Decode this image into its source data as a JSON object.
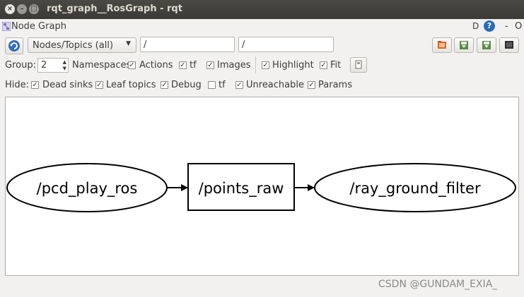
{
  "window": {
    "title": "rqt_graph__RosGraph - rqt",
    "close_glyph": "×",
    "min_glyph": "–",
    "max_glyph": "□"
  },
  "plugin": {
    "title": "Node Graph",
    "d_label": "D",
    "help_label": "?",
    "dash_label": "-",
    "o_label": "O"
  },
  "toolbar": {
    "mode_combo": "Nodes/Topics (all)",
    "node_filter": "/",
    "topic_filter": "/",
    "buttons": [
      "load-dot-icon",
      "save-dot-icon",
      "save-svg-icon",
      "save-image-icon"
    ]
  },
  "options": {
    "group_label": "Group:",
    "group_value": "2",
    "items": [
      {
        "label": "Namespaces",
        "checked": true
      },
      {
        "label": "Actions",
        "checked": true
      },
      {
        "label": "tf",
        "checked": true
      },
      {
        "label": "Images",
        "checked": true
      },
      {
        "label": "Highlight",
        "checked": true
      },
      {
        "label": "Fit",
        "checked": true
      }
    ]
  },
  "hide": {
    "label": "Hide:",
    "items": [
      {
        "label": "Dead sinks",
        "checked": true
      },
      {
        "label": "Leaf topics",
        "checked": true
      },
      {
        "label": "Debug",
        "checked": true
      },
      {
        "label": "tf",
        "checked": false
      },
      {
        "label": "Unreachable",
        "checked": true
      },
      {
        "label": "Params",
        "checked": true
      }
    ]
  },
  "graph": {
    "nodes": [
      {
        "label": "/pcd_play_ros",
        "kind": "node"
      },
      {
        "label": "/points_raw",
        "kind": "topic"
      },
      {
        "label": "/ray_ground_filter",
        "kind": "node"
      }
    ]
  },
  "watermark": "CSDN @GUNDAM_EXIA_",
  "colors": {
    "titlebar": "#3c3b37",
    "accent": "#2a6ab8",
    "background": "#f2f1f0"
  }
}
